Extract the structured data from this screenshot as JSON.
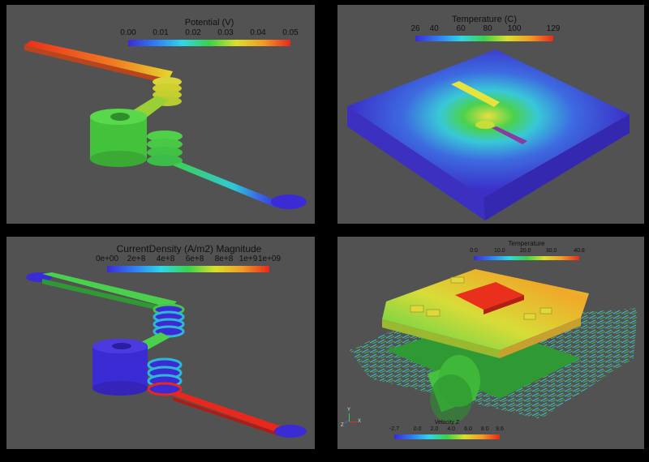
{
  "panels": [
    {
      "colorbar": {
        "title": "Potential (V)",
        "ticks": [
          "0.00",
          "0.01",
          "0.02",
          "0.03",
          "0.04",
          "0.05"
        ]
      }
    },
    {
      "colorbar": {
        "title": "Temperature (C)",
        "ticks": [
          "26",
          "40",
          "60",
          "80",
          "100",
          "129"
        ]
      }
    },
    {
      "colorbar": {
        "title": "CurrentDensity (A/m2) Magnitude",
        "ticks": [
          "0e+00",
          "2e+8",
          "4e+8",
          "6e+8",
          "8e+8",
          "1e+9",
          "1e+09"
        ]
      }
    },
    {
      "colorbar_top": {
        "title": "Temperature",
        "ticks": [
          "0.0",
          "10.0",
          "20.0",
          "30.0",
          "40.8"
        ]
      },
      "colorbar_bottom": {
        "title": "Velocity Z",
        "ticks": [
          "-2.7",
          "0.0",
          "2.0",
          "4.0",
          "6.0",
          "8.0",
          "9.6"
        ]
      },
      "axes": {
        "x": "X",
        "y": "Y",
        "z": "Z"
      }
    }
  ],
  "colors": {
    "background": "#000000",
    "panel": "#525252",
    "rainbow": [
      "#3b2bd4",
      "#2f7cf5",
      "#2fd6e8",
      "#3ad24a",
      "#d9e02c",
      "#f29a26",
      "#e8281c"
    ]
  }
}
